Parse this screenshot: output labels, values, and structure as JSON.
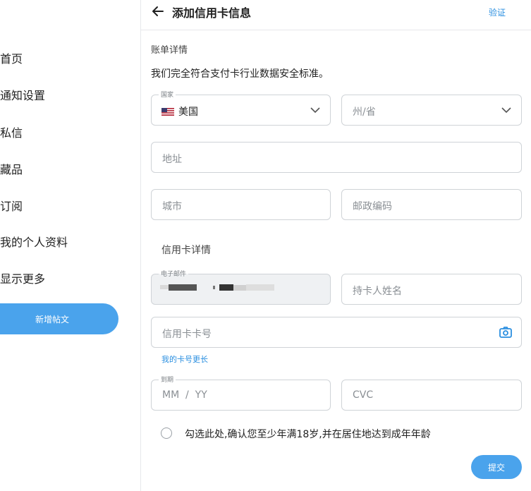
{
  "sidebar": {
    "items": [
      {
        "label": "首页"
      },
      {
        "label": "通知设置"
      },
      {
        "label": "私信"
      },
      {
        "label": "藏品"
      },
      {
        "label": "订阅"
      },
      {
        "label": "我的个人资料"
      },
      {
        "label": "显示更多"
      }
    ],
    "new_post_label": "新增帖文"
  },
  "header": {
    "title": "添加信用卡信息",
    "verify_label": "验证"
  },
  "billing": {
    "heading": "账单详情",
    "notice": "我们完全符合支付卡行业数据安全标准。",
    "country_legend": "国家",
    "country_value": "美国",
    "state_placeholder": "州/省",
    "address_placeholder": "地址",
    "city_placeholder": "城市",
    "zip_placeholder": "邮政编码"
  },
  "card": {
    "heading": "信用卡详情",
    "email_legend": "电子邮件",
    "holder_placeholder": "持卡人姓名",
    "number_placeholder": "信用卡卡号",
    "longer_card_link": "我的卡号更长",
    "expiry_legend": "到期",
    "expiry_placeholder": "MM  /  YY",
    "cvc_placeholder": "CVC"
  },
  "consent": {
    "label": "勾选此处,确认您至少年满18岁,并在居住地达到成年年龄"
  },
  "submit_label": "提交",
  "colors": {
    "accent": "#4aa3ec",
    "link": "#2b8fe0",
    "border": "#cfd3d7"
  }
}
